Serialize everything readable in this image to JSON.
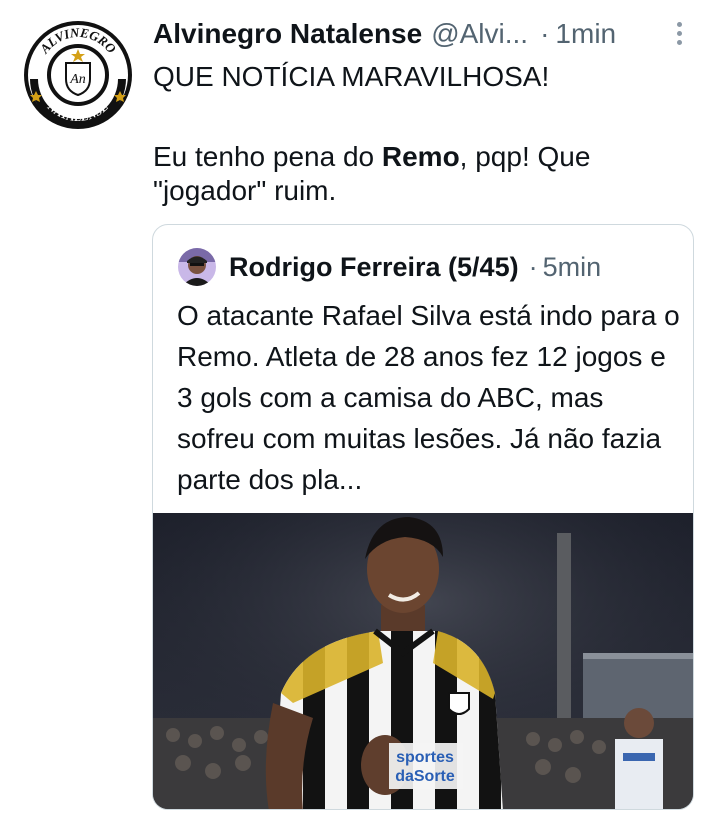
{
  "tweet": {
    "display_name": "Alvinegro Natalense",
    "handle": "@Alvi...",
    "separator": "·",
    "time": "1min",
    "line1": "QUE NOTÍCIA MARAVILHOSA!",
    "line2_part1": "Eu tenho pena do ",
    "line2_bold": "Remo",
    "line2_part2": ", pqp! Que",
    "line3": "\"jogador\" ruim.",
    "more_icon": "more-vertical-icon",
    "avatar_logo_top": "ALVINEGRO",
    "avatar_logo_bottom": "NATALENSE",
    "avatar_monogram": "An"
  },
  "quoted": {
    "display_name": "Rodrigo Ferreira (5/45)",
    "separator": "·",
    "time": "5min",
    "text": "O atacante Rafael Silva está indo para o Remo. Atleta de 28 anos fez 12 jogos e 3 gols com a camisa do ABC, mas sofreu com muitas lesões. Já não fazia parte dos pla...",
    "photo_sponsor_line1": "sportes",
    "photo_sponsor_line2": "daSorte"
  },
  "colors": {
    "text": "#0f1419",
    "muted": "#536471",
    "border": "#cfd9de"
  }
}
